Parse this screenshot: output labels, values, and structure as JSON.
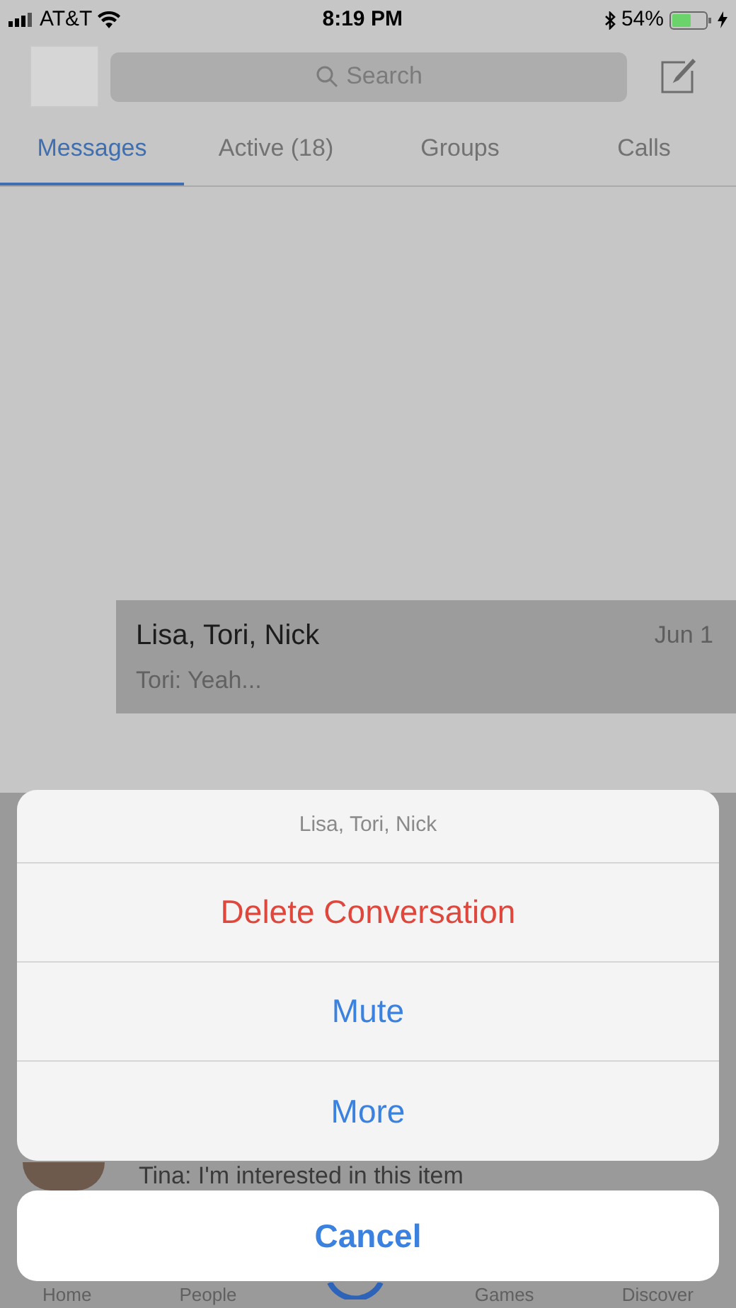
{
  "status_bar": {
    "carrier": "AT&T",
    "time": "8:19 PM",
    "battery": "54%"
  },
  "header": {
    "search": {
      "placeholder": "Search"
    }
  },
  "tabs": [
    {
      "label": "Messages",
      "selected": true
    },
    {
      "label": "Active (18)",
      "selected": false
    },
    {
      "label": "Groups",
      "selected": false
    },
    {
      "label": "Calls",
      "selected": false
    }
  ],
  "conversations": [
    {
      "name": "Lisa, Tori, Nick",
      "date": "Jun 1",
      "preview": "Tori: Yeah...",
      "highlighted": true
    },
    {
      "preview": "Tina: I'm interested in this item",
      "highlighted": false
    }
  ],
  "action_sheet": {
    "title": "Lisa, Tori, Nick",
    "actions": [
      {
        "label": "Delete Conversation",
        "kind": "destructive"
      },
      {
        "label": "Mute",
        "kind": "default"
      },
      {
        "label": "More",
        "kind": "default"
      }
    ],
    "cancel": "Cancel"
  },
  "bottom_tabs": [
    "Home",
    "People",
    "Games",
    "Discover"
  ]
}
